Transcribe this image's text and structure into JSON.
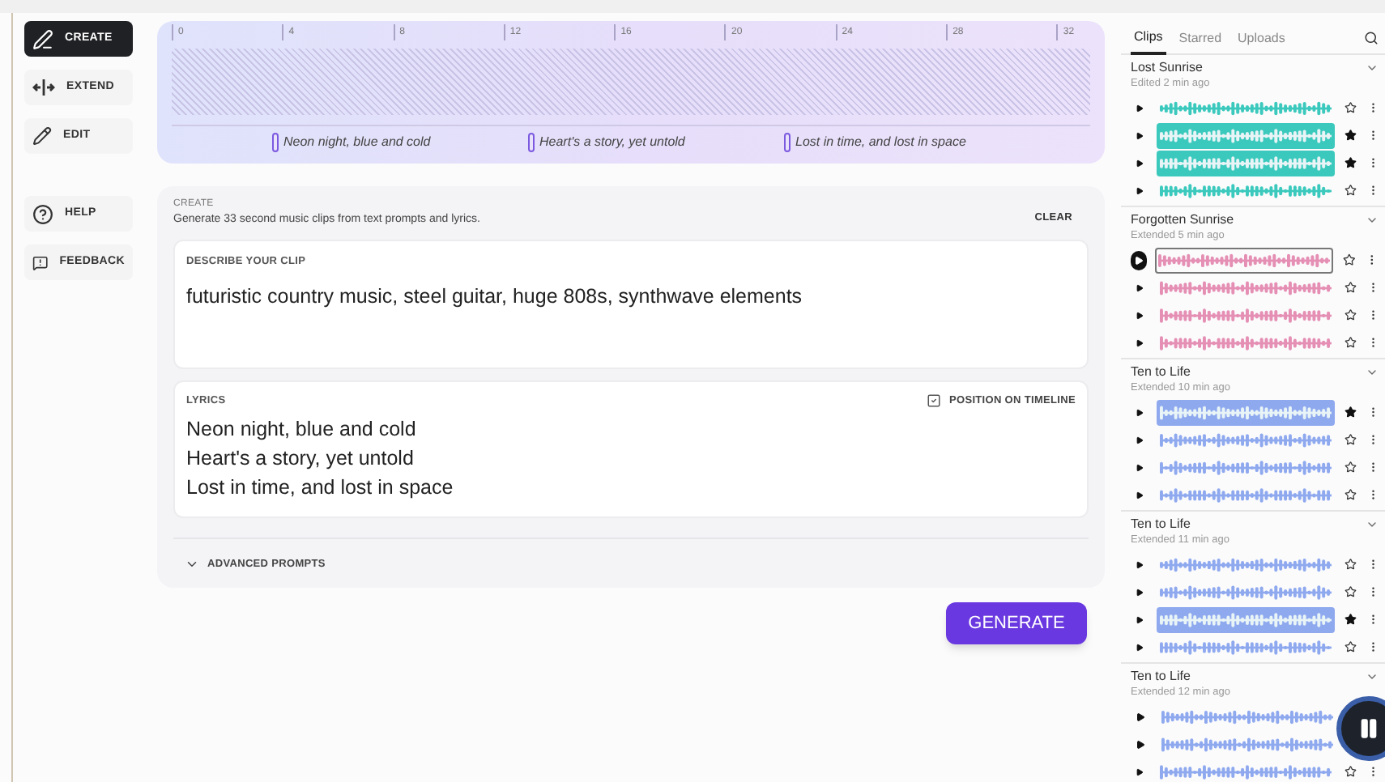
{
  "nav": [
    {
      "label": "CREATE",
      "selected": true
    },
    {
      "label": "EXTEND",
      "selected": false
    },
    {
      "label": "EDIT",
      "selected": false
    },
    {
      "label": "HELP",
      "selected": false
    },
    {
      "label": "FEEDBACK",
      "selected": false
    }
  ],
  "timeline": {
    "ticks": [
      "0",
      "4",
      "8",
      "12",
      "16",
      "20",
      "24",
      "28",
      "32"
    ],
    "lyrics": [
      "Neon night, blue and cold",
      "Heart's a story, yet untold",
      "Lost in time, and lost in space"
    ]
  },
  "create": {
    "heading": "CREATE",
    "description": "Generate 33 second music clips from text prompts and lyrics.",
    "clear": "CLEAR",
    "prompt": {
      "label": "DESCRIBE YOUR CLIP",
      "value": "futuristic country music, steel guitar, huge 808s, synthwave elements"
    },
    "lyrics": {
      "label": "LYRICS",
      "lines": [
        "Neon night, blue and cold",
        "Heart's a story, yet untold",
        "Lost in time, and lost in space"
      ],
      "position_label": "POSITION ON TIMELINE",
      "position_checked": true
    },
    "advanced": {
      "label": "ADVANCED PROMPTS",
      "expanded": false
    },
    "generate": "GENERATE"
  },
  "library": {
    "tabs": [
      {
        "label": "Clips",
        "selected": true
      },
      {
        "label": "Starred",
        "selected": false
      },
      {
        "label": "Uploads",
        "selected": false
      }
    ],
    "groups": [
      {
        "title": "Lost Sunrise",
        "subtitle": "Edited 2 min ago",
        "color": "#3cc9bd",
        "clips": [
          {
            "starred": false,
            "highlighted": false,
            "playing": false
          },
          {
            "starred": true,
            "highlighted": true,
            "playing": false
          },
          {
            "starred": true,
            "highlighted": true,
            "playing": false
          },
          {
            "starred": false,
            "highlighted": false,
            "playing": false
          }
        ]
      },
      {
        "title": "Forgotten Sunrise",
        "subtitle": "Extended 5 min ago",
        "color": "#e58fb4",
        "clips": [
          {
            "starred": false,
            "highlighted": false,
            "playing": true
          },
          {
            "starred": false,
            "highlighted": false,
            "playing": false
          },
          {
            "starred": false,
            "highlighted": false,
            "playing": false
          },
          {
            "starred": false,
            "highlighted": false,
            "playing": false
          }
        ]
      },
      {
        "title": "Ten to Life",
        "subtitle": "Extended 10 min ago",
        "color": "#8fa9ef",
        "clips": [
          {
            "starred": true,
            "highlighted": true,
            "playing": false
          },
          {
            "starred": false,
            "highlighted": false,
            "playing": false
          },
          {
            "starred": false,
            "highlighted": false,
            "playing": false
          },
          {
            "starred": false,
            "highlighted": false,
            "playing": false
          }
        ]
      },
      {
        "title": "Ten to Life",
        "subtitle": "Extended 11 min ago",
        "color": "#8fa9ef",
        "clips": [
          {
            "starred": false,
            "highlighted": false,
            "playing": false
          },
          {
            "starred": false,
            "highlighted": false,
            "playing": false
          },
          {
            "starred": true,
            "highlighted": true,
            "playing": false
          },
          {
            "starred": false,
            "highlighted": false,
            "playing": false
          }
        ]
      },
      {
        "title": "Ten to Life",
        "subtitle": "Extended 12 min ago",
        "color": "#8fa9ef",
        "clips": [
          {
            "highlighted": false,
            "playing": false
          },
          {
            "highlighted": false,
            "playing": false
          },
          {
            "starred": false,
            "highlighted": false,
            "playing": false
          }
        ]
      }
    ]
  }
}
